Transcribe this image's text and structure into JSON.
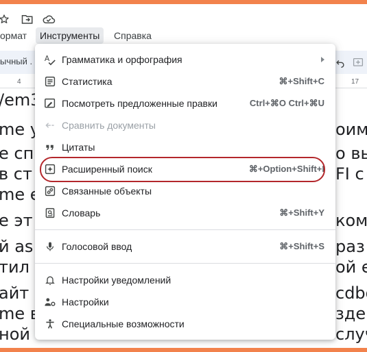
{
  "colors": {
    "frame": "#f2824c",
    "highlight_ring": "#b3272b",
    "shortcut": "#5f6368"
  },
  "top_icons": [
    "star-icon",
    "move-to-folder-icon",
    "cloud-saved-icon"
  ],
  "menubar": {
    "format": "ормат",
    "tools": "Инструменты",
    "help": "Справка"
  },
  "toolbar": {
    "style_value": "ычный ."
  },
  "ruler": {
    "left_num": "4",
    "right_num": "17"
  },
  "document": {
    "lines": [
      "/em3",
      "me у",
      "e сп",
      " в ст",
      "me е",
      "e эт",
      "й as",
      "тил",
      "айт",
      "me в",
      "ной"
    ],
    "right_fragments": [
      "оим",
      "о вы",
      "FI c",
      "комо",
      "раз",
      "ой е",
      "cdbo",
      "зде",
      "случ"
    ],
    "bottom_fragment": "…"
  },
  "menu": {
    "items": [
      {
        "label": "Грамматика и орфография",
        "shortcut": "",
        "icon": "spellcheck-icon",
        "submenu": true
      },
      {
        "label": "Статистика",
        "shortcut": "⌘+Shift+C",
        "icon": "word-count-icon"
      },
      {
        "label": "Посмотреть предложенные правки",
        "shortcut": "Ctrl+⌘O Ctrl+⌘U",
        "icon": "review-edits-icon"
      },
      {
        "label": "Сравнить документы",
        "shortcut": "",
        "icon": "compare-icon",
        "disabled": true
      },
      {
        "label": "Цитаты",
        "shortcut": "",
        "icon": "quote-icon"
      },
      {
        "label": "Расширенный поиск",
        "shortcut": "⌘+Option+Shift+I",
        "icon": "explore-icon"
      },
      {
        "label": "Связанные объекты",
        "shortcut": "",
        "icon": "linked-objects-icon"
      },
      {
        "label": "Словарь",
        "shortcut": "⌘+Shift+Y",
        "icon": "dictionary-icon"
      },
      {
        "label": "Голосовой ввод",
        "shortcut": "⌘+Shift+S",
        "icon": "microphone-icon"
      },
      {
        "label": "Настройки уведомлений",
        "shortcut": "",
        "icon": "bell-icon"
      },
      {
        "label": "Настройки",
        "shortcut": "",
        "icon": "preferences-icon"
      },
      {
        "label": "Специальные возможности",
        "shortcut": "",
        "icon": "accessibility-icon"
      }
    ]
  }
}
